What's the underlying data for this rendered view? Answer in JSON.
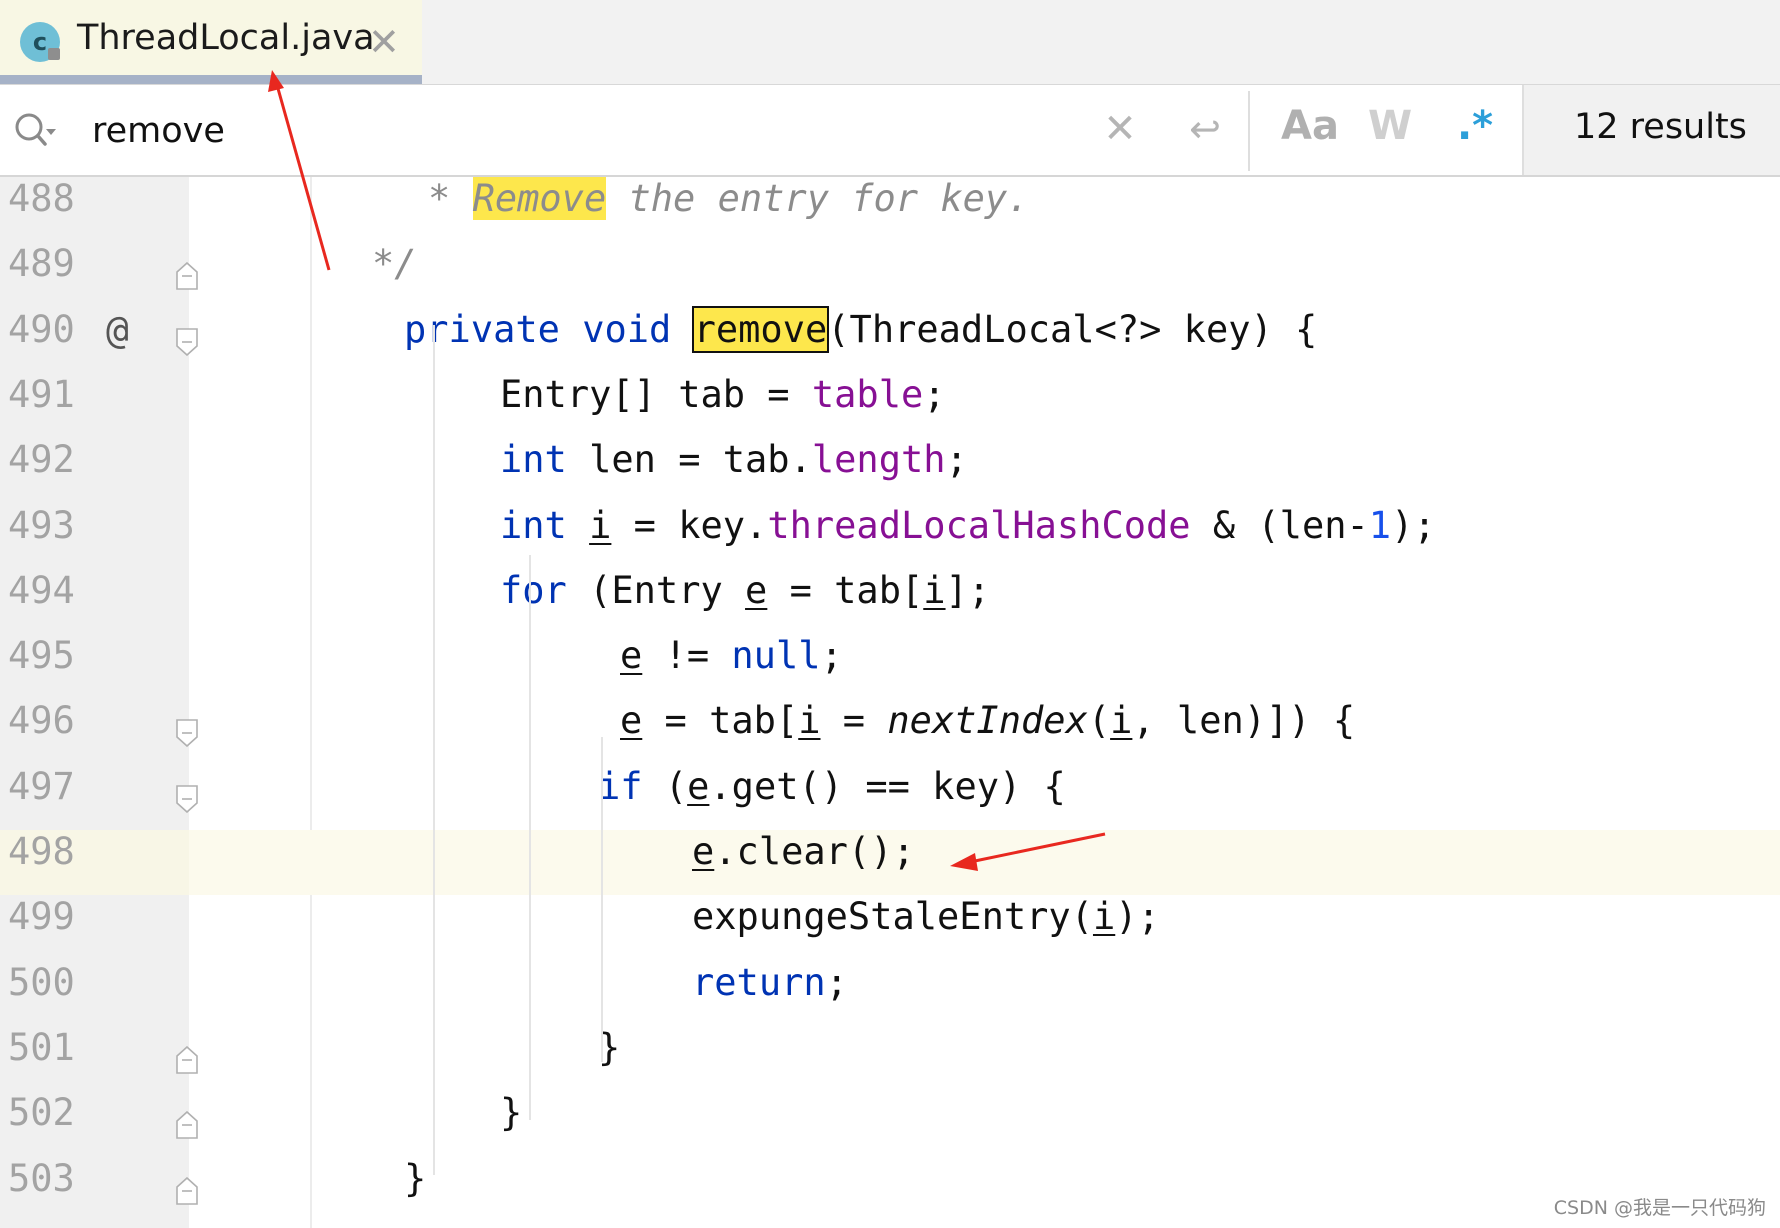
{
  "tab": {
    "title": "ThreadLocal.java",
    "file_icon_letter": "c",
    "close_icon": "✕"
  },
  "search": {
    "query": "remove",
    "clear_icon": "✕",
    "newline_icon": "↩",
    "match_case_label": "Aa",
    "whole_words_label": "W",
    "regex_label": ".*",
    "results": "12 results"
  },
  "colors": {
    "keyword": "#0033b3",
    "field": "#871094",
    "comment": "#8c8c8c",
    "number": "#1750eb",
    "highlight": "#fde74c",
    "current_line": "#fcfaed",
    "annotation_arrow": "#e8281f"
  },
  "gutter_icons": {
    "override": "@"
  },
  "lines": [
    {
      "num": "488",
      "fold": "",
      "tokens": [
        [
          "comment",
          "* "
        ],
        [
          "comment-hl",
          "Remove"
        ],
        [
          "comment",
          " the entry for key."
        ]
      ]
    },
    {
      "num": "489",
      "fold": "end",
      "tokens": [
        [
          "comment",
          "*/"
        ]
      ]
    },
    {
      "num": "490",
      "fold": "start",
      "override": true,
      "tokens": [
        [
          "keyword",
          "private"
        ],
        [
          "plain",
          " "
        ],
        [
          "keyword",
          "void"
        ],
        [
          "plain",
          " "
        ],
        [
          "hl-current",
          "remove"
        ],
        [
          "plain",
          "(ThreadLocal<?> key) {"
        ]
      ]
    },
    {
      "num": "491",
      "fold": "",
      "tokens": [
        [
          "plain",
          "Entry[] tab = "
        ],
        [
          "field",
          "table"
        ],
        [
          "plain",
          ";"
        ]
      ]
    },
    {
      "num": "492",
      "fold": "",
      "tokens": [
        [
          "keyword",
          "int"
        ],
        [
          "plain",
          " len = tab."
        ],
        [
          "field",
          "length"
        ],
        [
          "plain",
          ";"
        ]
      ]
    },
    {
      "num": "493",
      "fold": "",
      "tokens": [
        [
          "keyword",
          "int"
        ],
        [
          "plain",
          " "
        ],
        [
          "under",
          "i"
        ],
        [
          "plain",
          " = key."
        ],
        [
          "field",
          "threadLocalHashCode"
        ],
        [
          "plain",
          " & (len-"
        ],
        [
          "number",
          "1"
        ],
        [
          "plain",
          ");"
        ]
      ]
    },
    {
      "num": "494",
      "fold": "",
      "tokens": [
        [
          "keyword",
          "for"
        ],
        [
          "plain",
          " (Entry "
        ],
        [
          "under",
          "e"
        ],
        [
          "plain",
          " = tab["
        ],
        [
          "under",
          "i"
        ],
        [
          "plain",
          "];"
        ]
      ]
    },
    {
      "num": "495",
      "fold": "",
      "tokens": [
        [
          "under",
          "e"
        ],
        [
          "plain",
          " != "
        ],
        [
          "keyword",
          "null"
        ],
        [
          "plain",
          ";"
        ]
      ]
    },
    {
      "num": "496",
      "fold": "start",
      "tokens": [
        [
          "under",
          "e"
        ],
        [
          "plain",
          " = tab["
        ],
        [
          "under",
          "i"
        ],
        [
          "plain",
          " = "
        ],
        [
          "italic",
          "nextIndex"
        ],
        [
          "plain",
          "("
        ],
        [
          "under",
          "i"
        ],
        [
          "plain",
          ", len)]) {"
        ]
      ]
    },
    {
      "num": "497",
      "fold": "start",
      "tokens": [
        [
          "keyword",
          "if"
        ],
        [
          "plain",
          " ("
        ],
        [
          "under",
          "e"
        ],
        [
          "plain",
          ".get() == key) {"
        ]
      ]
    },
    {
      "num": "498",
      "fold": "",
      "current": true,
      "tokens": [
        [
          "under",
          "e"
        ],
        [
          "plain",
          ".clear();"
        ]
      ]
    },
    {
      "num": "499",
      "fold": "",
      "tokens": [
        [
          "plain",
          "expungeStaleEntry("
        ],
        [
          "under",
          "i"
        ],
        [
          "plain",
          ");"
        ]
      ]
    },
    {
      "num": "500",
      "fold": "",
      "tokens": [
        [
          "keyword",
          "return"
        ],
        [
          "plain",
          ";"
        ]
      ]
    },
    {
      "num": "501",
      "fold": "end",
      "tokens": [
        [
          "plain",
          "}"
        ]
      ]
    },
    {
      "num": "502",
      "fold": "end",
      "tokens": [
        [
          "plain",
          "}"
        ]
      ]
    },
    {
      "num": "503",
      "fold": "end",
      "tokens": [
        [
          "plain",
          "}"
        ]
      ]
    }
  ],
  "watermark": "CSDN @我是一只代码狗"
}
